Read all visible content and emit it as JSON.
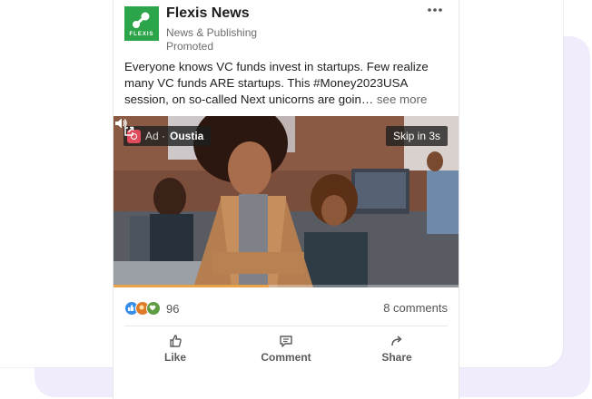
{
  "post": {
    "company_name": "Flexis News",
    "company_industry": "News & Publishing",
    "promoted_label": "Promoted",
    "logo_text": "FLEXIS",
    "more_icon": "more-horizontal-icon",
    "body_text": "Everyone knows VC funds invest in startups. Few realize many VC funds ARE startups. This #Money2023USA session, on so-called Next unicorns are goin…",
    "see_more_label": "see more"
  },
  "video": {
    "ad_label": "Ad ·",
    "advertiser": "Oustia",
    "skip_label": "Skip in 3s",
    "progress_fraction": 0.45,
    "volume_icon": "volume-icon",
    "external_icon": "external-link-icon"
  },
  "social": {
    "reaction_count": "96",
    "comments_label": "8 comments",
    "reaction_icons": [
      "like-reaction-icon",
      "celebrate-reaction-icon",
      "support-reaction-icon"
    ]
  },
  "actions": {
    "like_label": "Like",
    "comment_label": "Comment",
    "share_label": "Share"
  },
  "colors": {
    "brand_green": "#2ca54a",
    "background_lilac": "#f1ecfb",
    "progress_orange": "#e8a24a"
  }
}
